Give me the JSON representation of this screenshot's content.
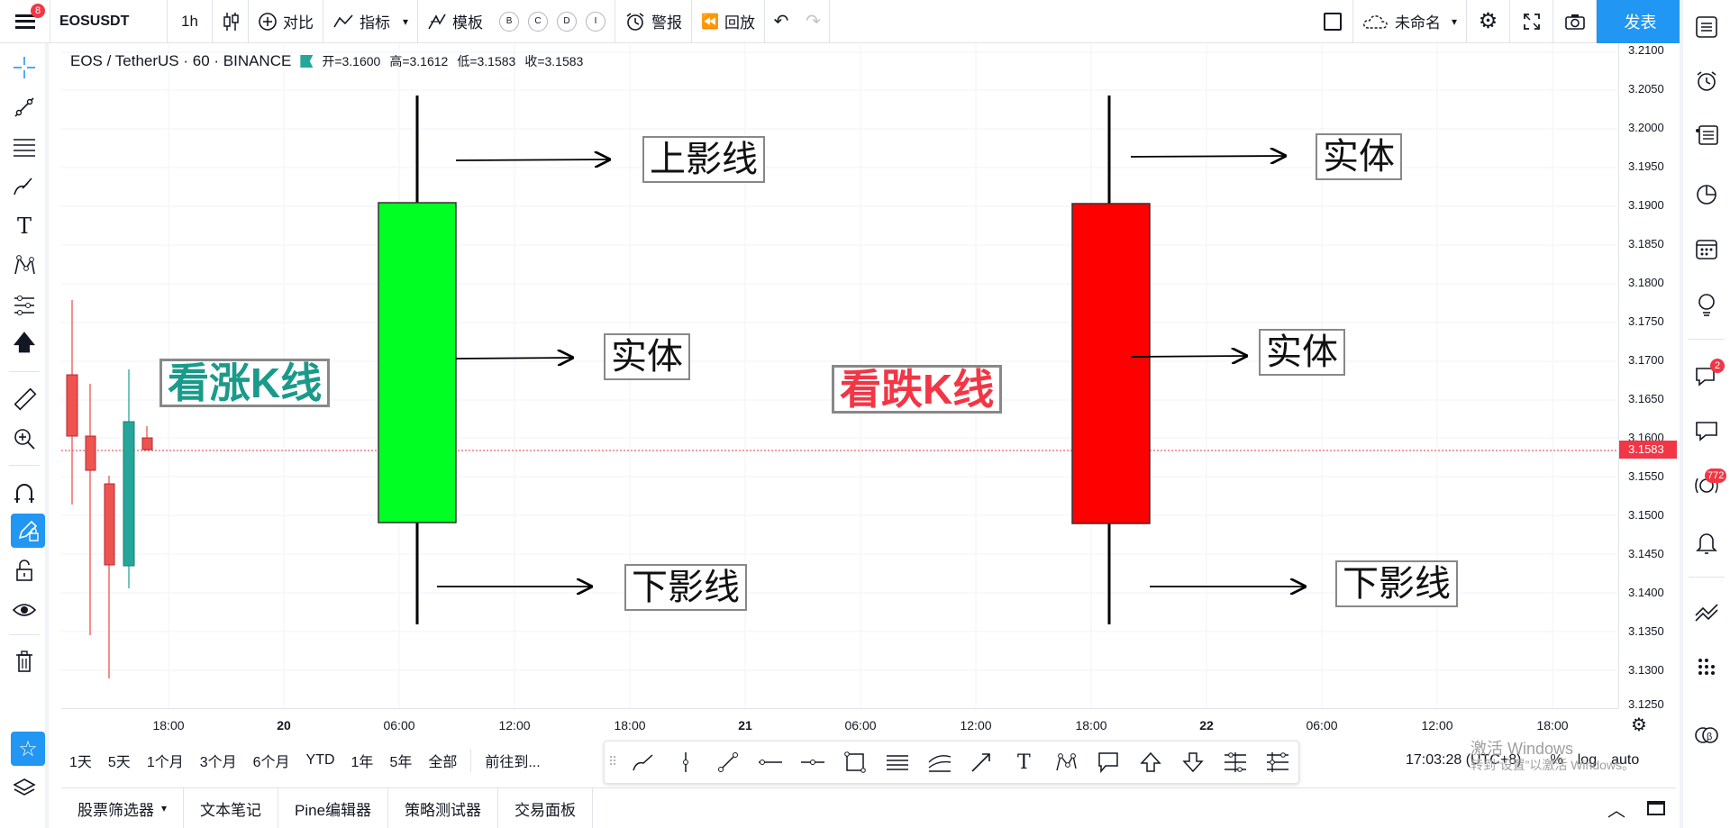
{
  "topbar": {
    "symbol": "EOSUSDT",
    "interval": "1h",
    "compare": "对比",
    "indicators": "指标",
    "templates": "模板",
    "chips": [
      "B",
      "C",
      "D",
      "I"
    ],
    "alert": "警报",
    "replay": "回放",
    "layout_name": "未命名",
    "publish": "发表",
    "menu_badge": "8"
  },
  "legend": {
    "title": "EOS / TetherUS · 60 · BINANCE",
    "open": "开=3.1600",
    "high": "高=3.1612",
    "low": "低=3.1583",
    "close": "收=3.1583"
  },
  "price_axis": {
    "ticks": [
      "3.2100",
      "3.2050",
      "3.2000",
      "3.1950",
      "3.1900",
      "3.1850",
      "3.1800",
      "3.1750",
      "3.1700",
      "3.1650",
      "3.1600",
      "3.1550",
      "3.1500",
      "3.1450",
      "3.1400",
      "3.1350",
      "3.1300",
      "3.1250"
    ],
    "current": "3.1583"
  },
  "time_axis": {
    "labels": [
      "18:00",
      "20",
      "06:00",
      "12:00",
      "18:00",
      "21",
      "06:00",
      "12:00",
      "18:00",
      "22",
      "06:00",
      "12:00",
      "18:00"
    ]
  },
  "annotations": {
    "bull_title": "看涨K线",
    "bear_title": "看跌K线",
    "upper_shadow": "上影线",
    "body": "实体",
    "lower_shadow": "下影线",
    "bear_upper": "实体",
    "bear_body": "实体",
    "bear_lower": "下影线"
  },
  "colors": {
    "bull_candle": "#00ff22",
    "bear_candle": "#ff0000",
    "bull_title": "#1a9a8a",
    "bear_title": "#f23645",
    "accent": "#2196f3",
    "up": "#26a69a",
    "down": "#ef5350"
  },
  "rangebar": {
    "ranges": [
      "1天",
      "5天",
      "1个月",
      "3个月",
      "6个月",
      "YTD",
      "1年",
      "5年",
      "全部"
    ],
    "goto": "前往到..."
  },
  "status": {
    "time": "17:03:28 (UTC+8)",
    "percent": "%",
    "log": "log",
    "auto": "auto"
  },
  "watermark": {
    "line1": "激活 Windows",
    "line2": "转到“设置”以激活 Windows。"
  },
  "tabs": [
    "股票筛选器",
    "文本笔记",
    "Pine编辑器",
    "策略测试器",
    "交易面板"
  ],
  "rightbar_badges": {
    "chat": "2",
    "ideas": "772"
  }
}
